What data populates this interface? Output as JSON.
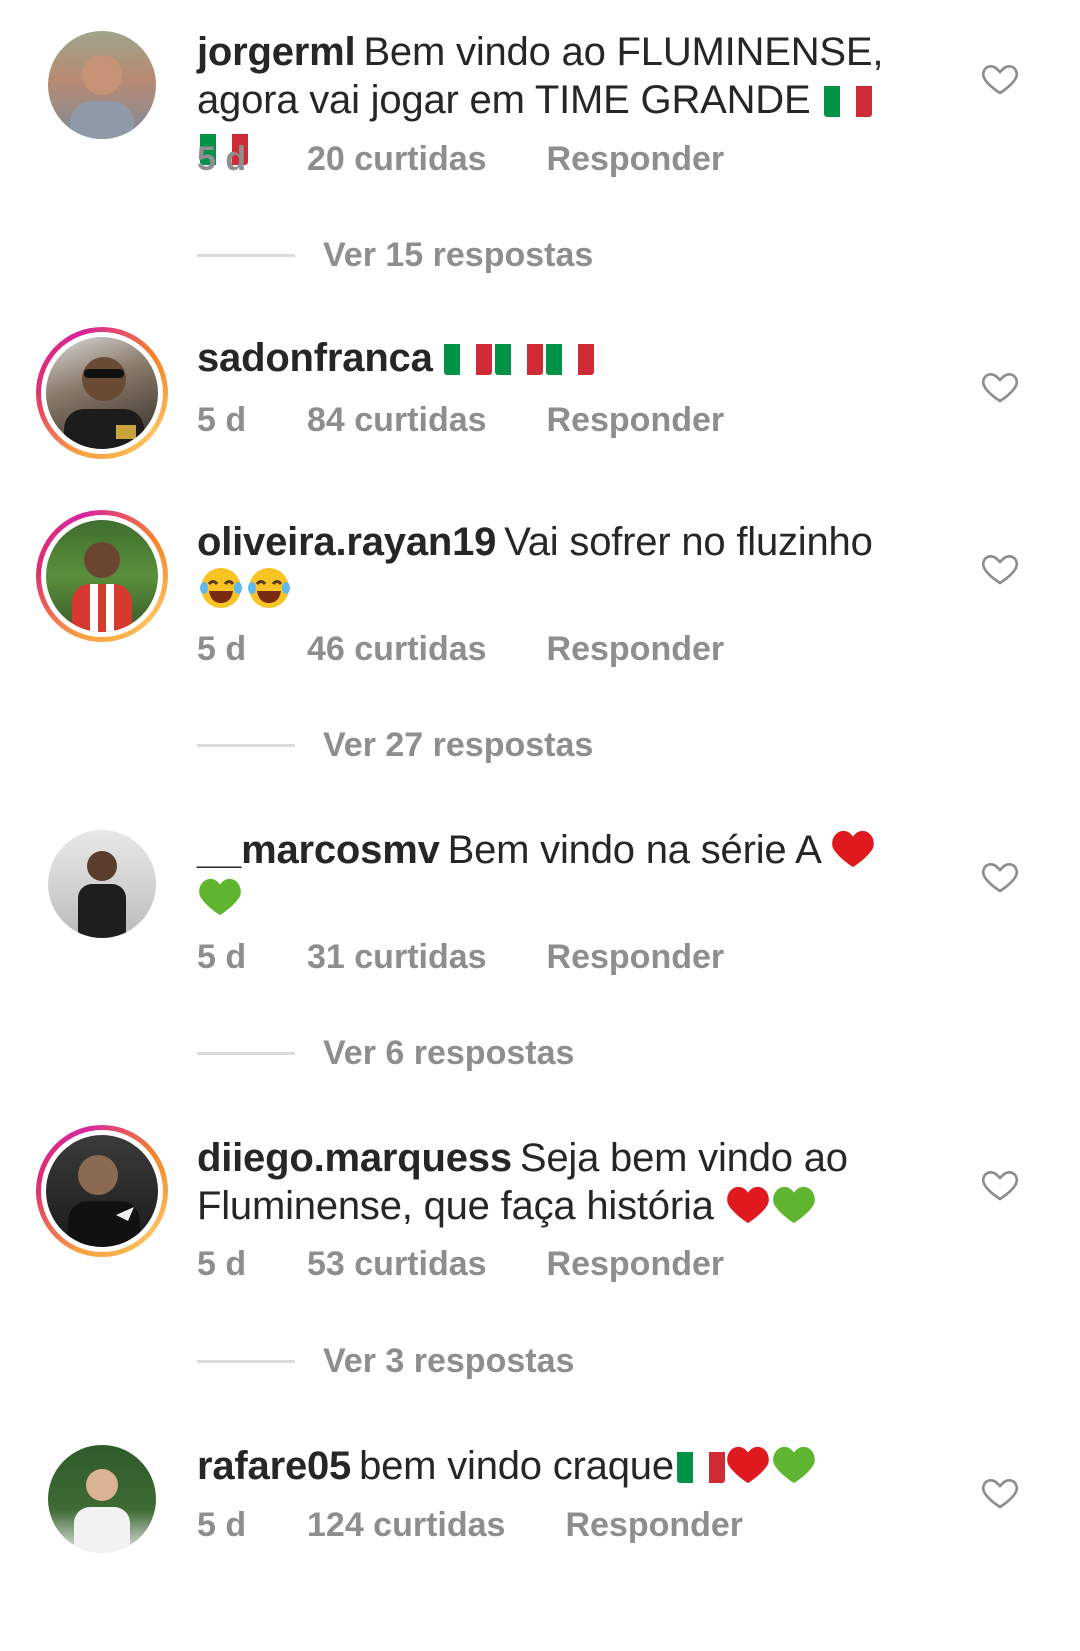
{
  "comments": [
    {
      "username": "jorgerml",
      "text": "Bem vindo ao FLUMINENSE, agora vai jogar em TIME GRANDE",
      "emojis": [
        "italy-flag",
        "italy-flag"
      ],
      "time": "5 d",
      "likes": "20 curtidas",
      "reply": "Responder",
      "view_replies": "Ver 15 respostas",
      "has_story": false
    },
    {
      "username": "sadonfranca",
      "text": "",
      "emojis": [
        "italy-flag",
        "italy-flag",
        "italy-flag"
      ],
      "time": "5 d",
      "likes": "84 curtidas",
      "reply": "Responder",
      "view_replies": "",
      "has_story": true
    },
    {
      "username": "oliveira.rayan19",
      "text": "Vai sofrer no fluzinho",
      "emojis": [
        "laughing-face",
        "laughing-face"
      ],
      "time": "5 d",
      "likes": "46 curtidas",
      "reply": "Responder",
      "view_replies": "Ver 27 respostas",
      "has_story": true
    },
    {
      "username": "__marcosmv",
      "text": "Bem vindo na série A",
      "emojis": [
        "red-heart",
        "green-heart"
      ],
      "time": "5 d",
      "likes": "31 curtidas",
      "reply": "Responder",
      "view_replies": "Ver 6 respostas",
      "has_story": false
    },
    {
      "username": "diiego.marquess",
      "text": "Seja bem vindo ao Fluminense, que faça história",
      "emojis": [
        "red-heart",
        "green-heart"
      ],
      "time": "5 d",
      "likes": "53 curtidas",
      "reply": "Responder",
      "view_replies": "Ver 3 respostas",
      "has_story": true
    },
    {
      "username": "rafare05",
      "text": "bem vindo craque",
      "emojis": [
        "italy-flag",
        "red-heart",
        "green-heart"
      ],
      "time": "5 d",
      "likes": "124 curtidas",
      "reply": "Responder",
      "view_replies": "",
      "has_story": false
    }
  ],
  "colors": {
    "text": "#262626",
    "meta": "#8e8e8e",
    "divider": "#dbdbdb",
    "flag_green": "#009246",
    "flag_white": "#ffffff",
    "flag_red": "#ce2b37",
    "heart_red": "#e0191e",
    "heart_green": "#5fb52f"
  }
}
